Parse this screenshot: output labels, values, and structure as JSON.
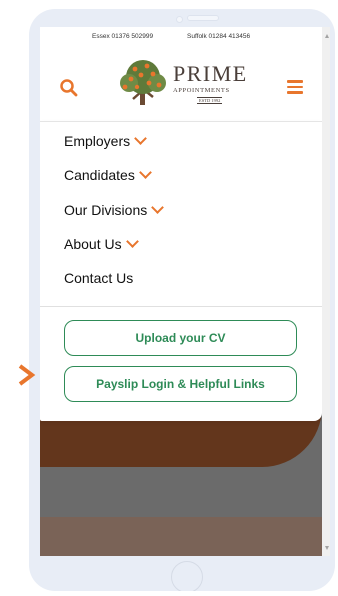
{
  "topbar": {
    "essex": "Essex 01376 502999",
    "suffolk": "Suffolk 01284 413456"
  },
  "header": {
    "brand_name": "PRIME",
    "brand_sub": "APPOINTMENTS",
    "brand_estd": "ESTD 1992"
  },
  "menu": {
    "items": [
      {
        "label": "Employers",
        "has_chevron": true
      },
      {
        "label": "Candidates",
        "has_chevron": true
      },
      {
        "label": "Our Divisions",
        "has_chevron": true
      },
      {
        "label": "About Us",
        "has_chevron": true
      },
      {
        "label": "Contact Us",
        "has_chevron": false
      }
    ],
    "upload_cv": "Upload your CV",
    "payslip": "Payslip Login & Helpful Links"
  },
  "icons": {
    "search": "search-icon",
    "menu": "hamburger-icon",
    "pointer": "chevron-right-icon"
  },
  "colors": {
    "accent": "#e8762d",
    "green": "#2e8b57",
    "phone_frame": "#e8edf6"
  }
}
